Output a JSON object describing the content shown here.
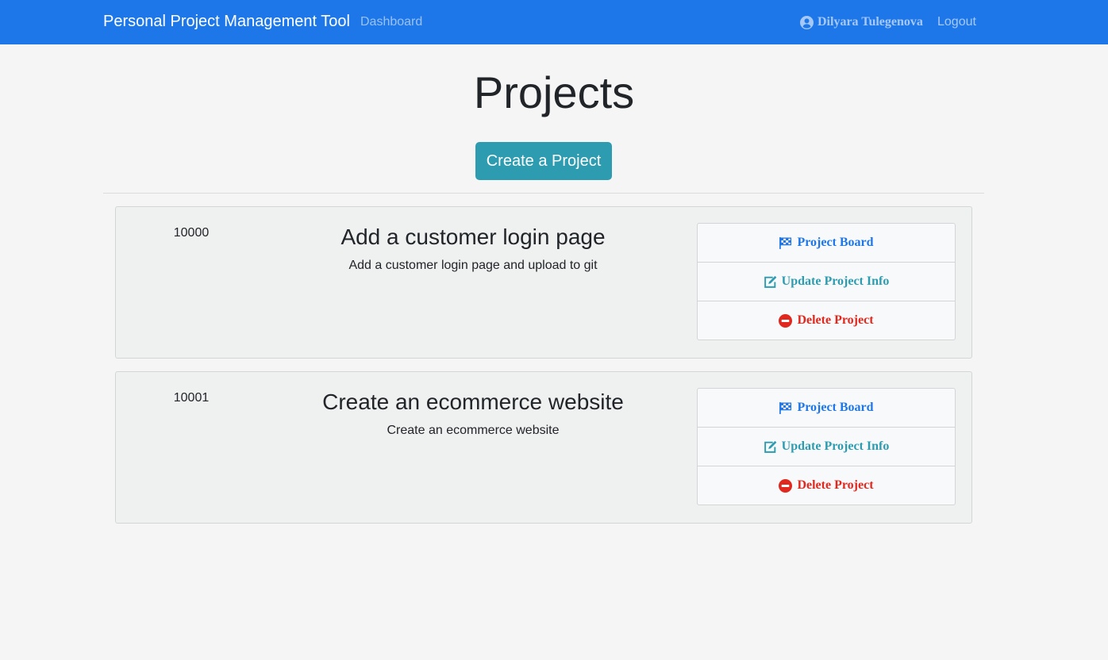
{
  "navbar": {
    "brand": "Personal Project Management Tool",
    "dashboard_link": "Dashboard",
    "user_name": "Dilyara Tulegenova",
    "user_icon": "user-circle-icon",
    "logout_link": "Logout",
    "background_color": "#1e77e8"
  },
  "page": {
    "title": "Projects",
    "create_button": "Create a Project",
    "create_button_color": "#2d9cb0"
  },
  "projects": [
    {
      "id": "10000",
      "name": "Add a customer login page",
      "description": "Add a customer login page and upload to git",
      "actions": {
        "board": "Project Board",
        "update": "Update Project Info",
        "delete": "Delete Project"
      }
    },
    {
      "id": "10001",
      "name": "Create an ecommerce website",
      "description": "Create an ecommerce website",
      "actions": {
        "board": "Project Board",
        "update": "Update Project Info",
        "delete": "Delete Project"
      }
    }
  ],
  "icons": {
    "board": "flag-checkered-icon",
    "update": "edit-icon",
    "delete": "minus-circle-icon"
  },
  "colors": {
    "board": "#1e77e8",
    "update": "#2d9cb0",
    "delete": "#e0281e"
  }
}
